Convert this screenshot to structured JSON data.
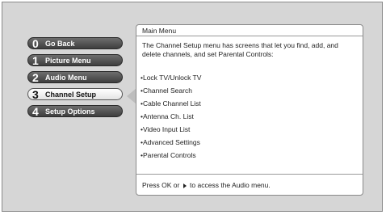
{
  "menu": {
    "items": [
      {
        "num": "0",
        "label": "Go Back",
        "selected": false
      },
      {
        "num": "1",
        "label": "Picture Menu",
        "selected": false
      },
      {
        "num": "2",
        "label": "Audio Menu",
        "selected": false
      },
      {
        "num": "3",
        "label": "Channel Setup",
        "selected": true
      },
      {
        "num": "4",
        "label": "Setup Options",
        "selected": false
      }
    ]
  },
  "panel": {
    "title": "Main Menu",
    "description": "The Channel Setup menu has screens that let you find, add, and delete channels, and set Parental Controls:",
    "items": [
      "•Lock TV/Unlock TV",
      "•Channel Search",
      "•Cable Channel List",
      "•Antenna Ch. List",
      "•Video Input List",
      "•Advanced Settings",
      "•Parental Controls"
    ],
    "hint_before": "Press OK or",
    "hint_after": "to access the Audio menu."
  },
  "icons": {
    "pointer": "left-pointer-icon",
    "hint_arrow": "play-icon"
  }
}
